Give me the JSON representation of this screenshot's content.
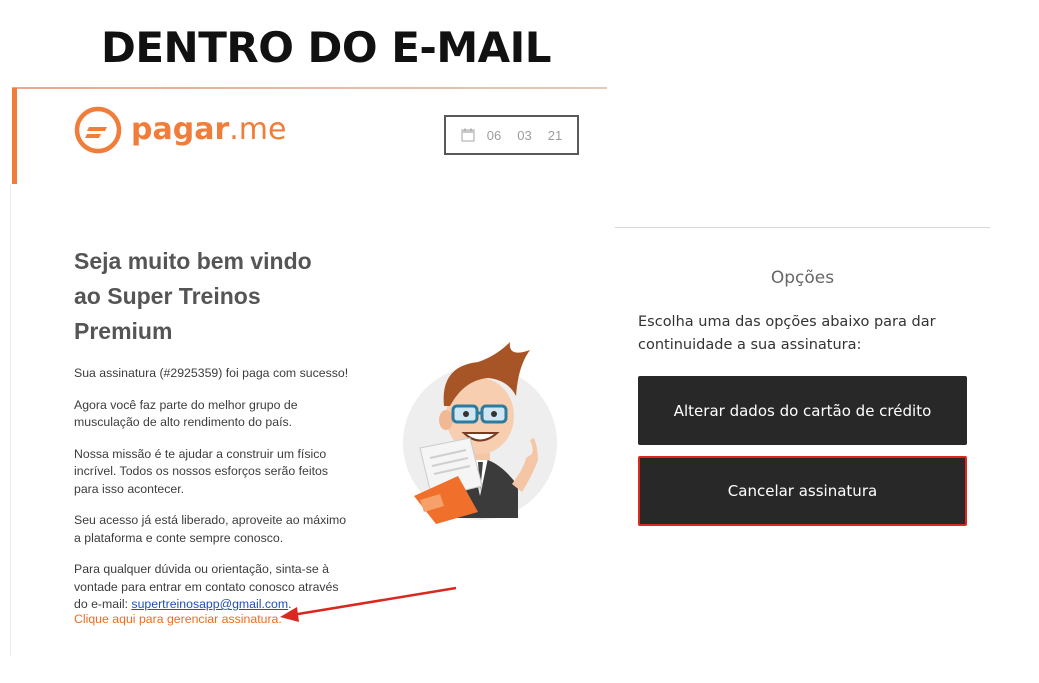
{
  "heading": "DENTRO DO E-MAIL",
  "email": {
    "brand": {
      "name_bold": "pagar",
      "name_light": ".me"
    },
    "date": {
      "day": "06",
      "month": "03",
      "year": "21"
    },
    "title": "Seja muito bem vindo ao Super Treinos Premium",
    "paragraphs": [
      "Sua assinatura (#2925359) foi paga com sucesso!",
      "Agora você faz parte do melhor grupo de musculação de alto rendimento do país.",
      "Nossa missão é te ajudar a construir um físico incrível. Todos os nossos esforços serão feitos para isso acontecer.",
      "Seu acesso já está liberado, aproveite ao máximo a plataforma e conte sempre conosco."
    ],
    "contact_text": "Para qualquer dúvida ou orientação, sinta-se à vontade para entrar em contato conosco através do e-mail: ",
    "contact_email": "supertreinosapp@gmail.com",
    "contact_end": ".",
    "manage_link": "Clique aqui para gerenciar assinatura."
  },
  "options": {
    "title": "Opções",
    "description": "Escolha uma das opções abaixo para dar continuidade a sua assinatura:",
    "alter_button": "Alterar dados do cartão de crédito",
    "cancel_button": "Cancelar assinatura"
  },
  "colors": {
    "brand_orange": "#f07d3a",
    "highlight_red": "#d9281f",
    "button_dark": "#282828"
  }
}
